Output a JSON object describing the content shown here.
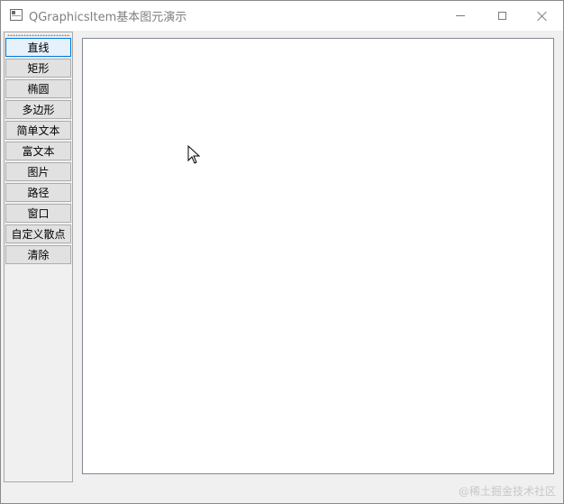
{
  "window": {
    "title": "QGraphicsItem基本图元演示",
    "icon": "app-window-icon",
    "controls": [
      "minimize-icon",
      "maximize-icon",
      "close-icon"
    ]
  },
  "toolbar": {
    "buttons": [
      {
        "label": "直线",
        "focused": true
      },
      {
        "label": "矩形",
        "focused": false
      },
      {
        "label": "椭圆",
        "focused": false
      },
      {
        "label": "多边形",
        "focused": false
      },
      {
        "label": "简单文本",
        "focused": false
      },
      {
        "label": "富文本",
        "focused": false
      },
      {
        "label": "图片",
        "focused": false
      },
      {
        "label": "路径",
        "focused": false
      },
      {
        "label": "窗口",
        "focused": false
      },
      {
        "label": "自定义散点",
        "focused": false
      },
      {
        "label": "清除",
        "focused": false
      }
    ]
  },
  "canvas": {
    "background": "#ffffff",
    "cursor": "arrow-cursor-icon"
  },
  "watermark": "@稀土掘金技术社区",
  "colors": {
    "focus_border": "#0078d7",
    "button_bg": "#e1e1e1",
    "window_bg": "#f0f0f0"
  }
}
